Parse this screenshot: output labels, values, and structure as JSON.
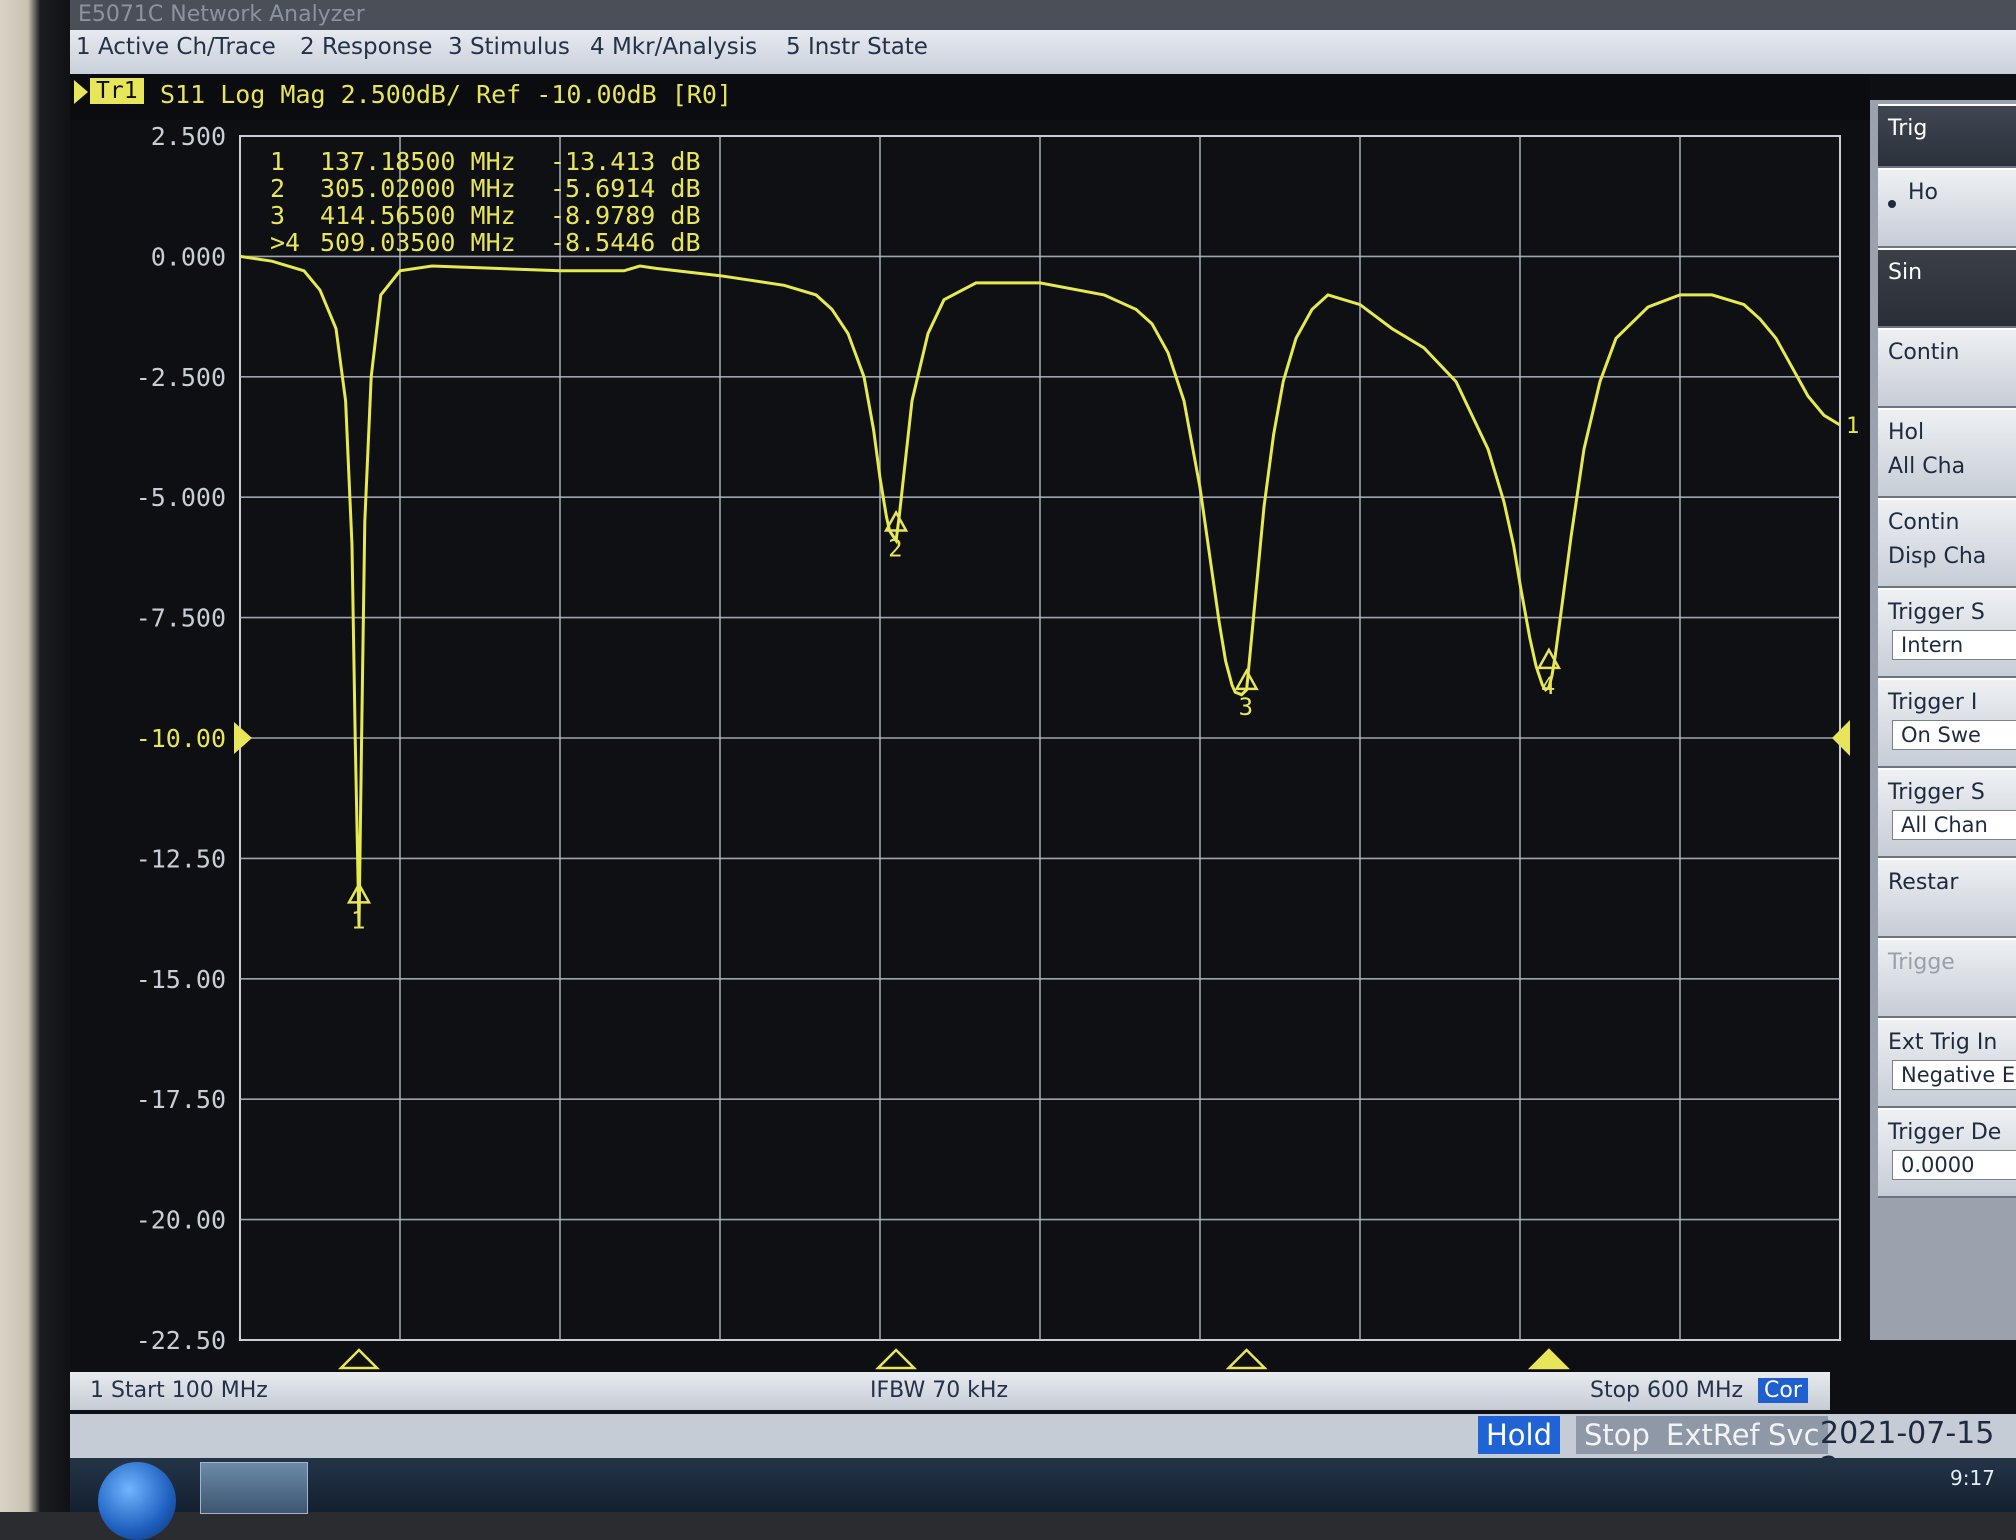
{
  "window_title": "E5071C Network Analyzer",
  "menu": [
    "1 Active Ch/Trace",
    "2 Response",
    "3 Stimulus",
    "4 Mkr/Analysis",
    "5 Instr State"
  ],
  "trace": {
    "badge": "Tr1",
    "info": "S11 Log Mag 2.500dB/ Ref -10.00dB [R0]"
  },
  "markers": [
    {
      "id": "1",
      "label": "1",
      "freq": "137.18500 MHz",
      "value": "-13.413 dB"
    },
    {
      "id": "2",
      "label": "2",
      "freq": "305.02000 MHz",
      "value": "-5.6914 dB"
    },
    {
      "id": "3",
      "label": "3",
      "freq": "414.56500 MHz",
      "value": "-8.9789 dB"
    },
    {
      "id": "4",
      "label": ">4",
      "freq": "509.03500 MHz",
      "value": "-8.5446 dB"
    }
  ],
  "status": {
    "start": "1  Start 100 MHz",
    "ifbw": "IFBW 70 kHz",
    "stop": "Stop 600 MHz",
    "cor": "Cor"
  },
  "states": [
    "Hold",
    "Stop",
    "ExtRef",
    "Svc"
  ],
  "datetime": "2021-07-15 2",
  "clock": "9:17",
  "softkeys": [
    {
      "l1": "Trig",
      "l2": "",
      "style": "title"
    },
    {
      "l1": "Ho",
      "l2": "",
      "style": "radio"
    },
    {
      "l1": "Sin",
      "l2": "",
      "style": "dark"
    },
    {
      "l1": "Contin",
      "l2": "",
      "style": ""
    },
    {
      "l1": "Hol",
      "l2": "All Cha",
      "style": ""
    },
    {
      "l1": "Contin",
      "l2": "Disp Cha",
      "style": ""
    },
    {
      "l1": "Trigger S",
      "val": "Intern",
      "style": "val"
    },
    {
      "l1": "Trigger I",
      "val": "On Swe",
      "style": "val"
    },
    {
      "l1": "Trigger S",
      "val": "All Chan",
      "style": "val"
    },
    {
      "l1": "Restar",
      "l2": "",
      "style": ""
    },
    {
      "l1": "Trigge",
      "l2": "",
      "style": "dim"
    },
    {
      "l1": "Ext Trig In",
      "val": "Negative E",
      "style": "val"
    },
    {
      "l1": "Trigger De",
      "val": "0.0000",
      "style": "val"
    }
  ],
  "chart_data": {
    "type": "line",
    "title": "",
    "xlabel": "",
    "ylabel": "",
    "xlim": [
      100,
      600
    ],
    "ylim": [
      -22.5,
      2.5
    ],
    "y_ticks": [
      "2.500",
      "0.000",
      "-2.500",
      "-5.000",
      "-7.500",
      "-10.00",
      "-12.50",
      "-15.00",
      "-17.50",
      "-20.00",
      "-22.50"
    ],
    "reference_level": -10.0,
    "grid": true,
    "series": [
      {
        "name": "",
        "color": "#e6ea4f",
        "x": [
          100,
          110,
          120,
          125,
          130,
          133,
          135,
          136,
          137.185,
          138,
          139,
          141,
          144,
          150,
          160,
          180,
          200,
          220,
          225,
          230,
          250,
          270,
          280,
          285,
          290,
          295,
          298,
          300,
          302,
          303,
          305.02,
          306,
          308,
          310,
          315,
          320,
          330,
          350,
          370,
          380,
          385,
          390,
          395,
          400,
          403,
          406,
          408,
          410,
          411,
          413,
          414.565,
          415,
          416,
          418,
          420,
          423,
          426,
          430,
          435,
          440,
          450,
          460,
          470,
          480,
          490,
          495,
          498,
          500,
          503,
          505,
          507,
          508,
          509.035,
          510,
          511,
          513,
          516,
          520,
          525,
          530,
          540,
          550,
          560,
          570,
          575,
          580,
          585,
          590,
          595,
          600
        ],
        "y": [
          0.0,
          -0.1,
          -0.3,
          -0.7,
          -1.5,
          -3.0,
          -6.0,
          -10.0,
          -13.9,
          -10.0,
          -5.5,
          -2.5,
          -0.8,
          -0.3,
          -0.2,
          -0.25,
          -0.3,
          -0.3,
          -0.2,
          -0.25,
          -0.4,
          -0.6,
          -0.8,
          -1.1,
          -1.6,
          -2.5,
          -3.6,
          -4.6,
          -5.4,
          -5.7,
          -5.9,
          -5.4,
          -4.2,
          -3.0,
          -1.6,
          -0.9,
          -0.55,
          -0.55,
          -0.8,
          -1.1,
          -1.4,
          -2.0,
          -3.0,
          -4.8,
          -6.2,
          -7.6,
          -8.4,
          -8.9,
          -9.05,
          -9.1,
          -9.0,
          -8.7,
          -8.0,
          -6.6,
          -5.2,
          -3.7,
          -2.6,
          -1.7,
          -1.1,
          -0.8,
          -1.0,
          -1.5,
          -1.9,
          -2.6,
          -4.0,
          -5.1,
          -6.0,
          -6.8,
          -7.9,
          -8.5,
          -8.9,
          -9.0,
          -8.95,
          -8.7,
          -8.3,
          -7.3,
          -5.8,
          -4.0,
          -2.6,
          -1.7,
          -1.05,
          -0.8,
          -0.8,
          -1.0,
          -1.3,
          -1.7,
          -2.3,
          -2.9,
          -3.3,
          -3.5
        ]
      }
    ]
  }
}
